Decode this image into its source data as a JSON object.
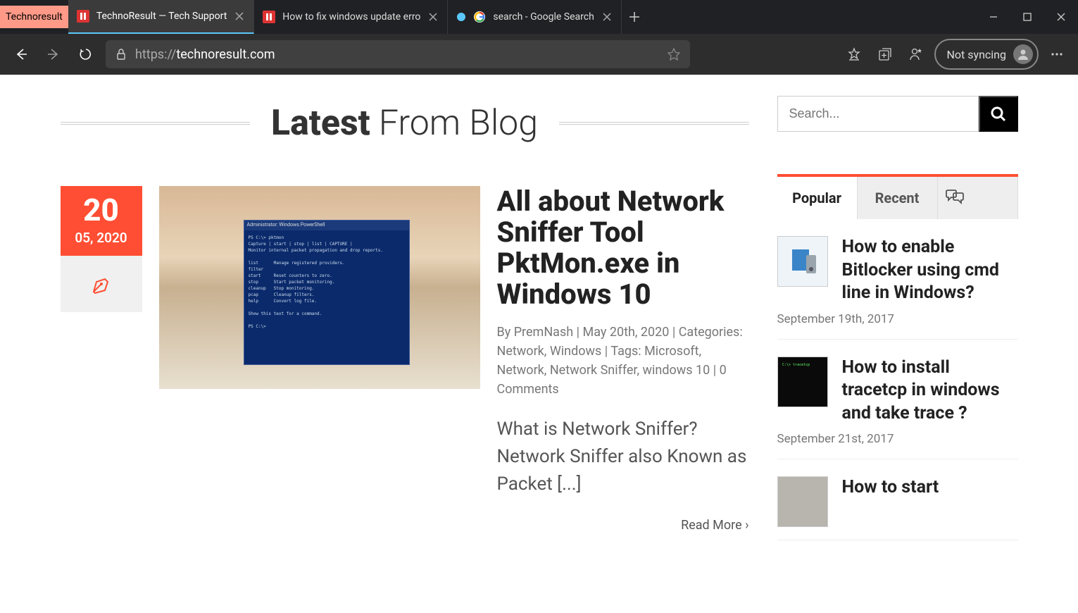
{
  "browser": {
    "tab_overlay": "Technoresult",
    "tabs": [
      {
        "title": "TechnoResult — Tech Support",
        "active": true,
        "favicon_color": "#d33"
      },
      {
        "title": "How to fix windows update erro",
        "active": false,
        "favicon_color": "#d33"
      },
      {
        "title": "search - Google Search",
        "active": false,
        "favicon_color": "#4285f4",
        "has_extra_dot": true
      }
    ],
    "url_protocol": "https://",
    "url_domain": "technoresult.com",
    "sync_label": "Not syncing"
  },
  "page": {
    "section_title_bold": "Latest",
    "section_title_rest": " From Blog",
    "post": {
      "date_day": "20",
      "date_rest": "05, 2020",
      "title": "All about Network Sniffer Tool PktMon.exe in Windows 10",
      "meta_by": "By ",
      "meta_author": "PremNash",
      "meta_sep1": " | ",
      "meta_date": "May 20th, 2020",
      "meta_sep2": " | Categories: ",
      "meta_cat1": "Network",
      "meta_catsep": ", ",
      "meta_cat2": "Windows",
      "meta_sep3": " | Tags: ",
      "meta_tag1": "Microsoft",
      "meta_tag2": "Network",
      "meta_tag3": "Network Sniffer",
      "meta_tag4": "windows 10",
      "meta_sep4": " | ",
      "meta_comments": "0 Comments",
      "excerpt": "What is Network Sniffer? Network Sniffer also Known as Packet [...]",
      "read_more": "Read More"
    },
    "sidebar": {
      "search_placeholder": "Search...",
      "tabs": {
        "popular": "Popular",
        "recent": "Recent"
      },
      "popular": [
        {
          "title": "How to enable Bitlocker using cmd line in Windows?",
          "date": "September 19th, 2017",
          "thumb": "light"
        },
        {
          "title": "How to install tracetcp in windows and take trace ?",
          "date": "September 21st, 2017",
          "thumb": "black"
        },
        {
          "title": "How to start",
          "date": "",
          "thumb": "gray"
        }
      ]
    }
  }
}
